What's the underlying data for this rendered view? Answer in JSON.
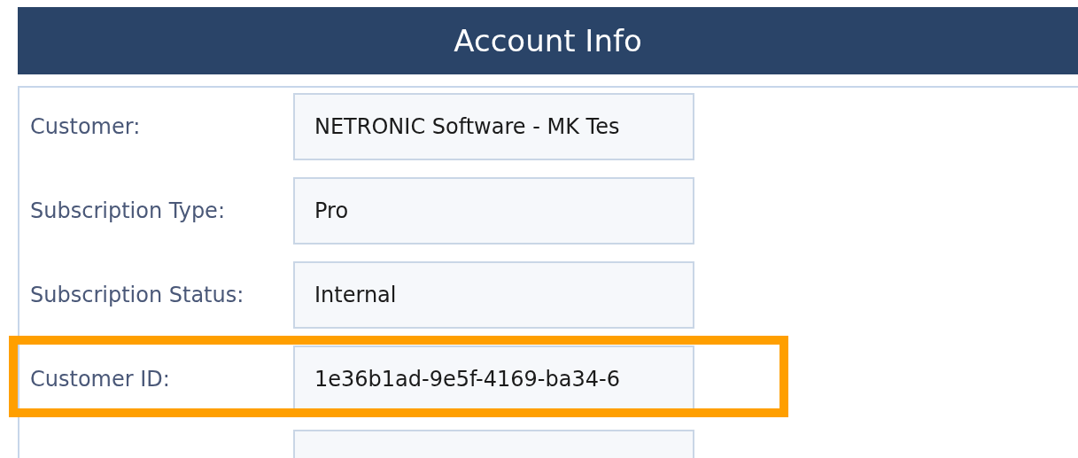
{
  "header": {
    "title": "Account Info"
  },
  "rows": [
    {
      "label": "Customer:",
      "value": "NETRONIC Software - MK Tes",
      "highlighted": false
    },
    {
      "label": "Subscription Type:",
      "value": "Pro",
      "highlighted": false
    },
    {
      "label": "Subscription Status:",
      "value": "Internal",
      "highlighted": false
    },
    {
      "label": "Customer ID:",
      "value": "1e36b1ad-9e5f-4169-ba34-6",
      "highlighted": true
    },
    {
      "highlighted": false
    }
  ]
}
